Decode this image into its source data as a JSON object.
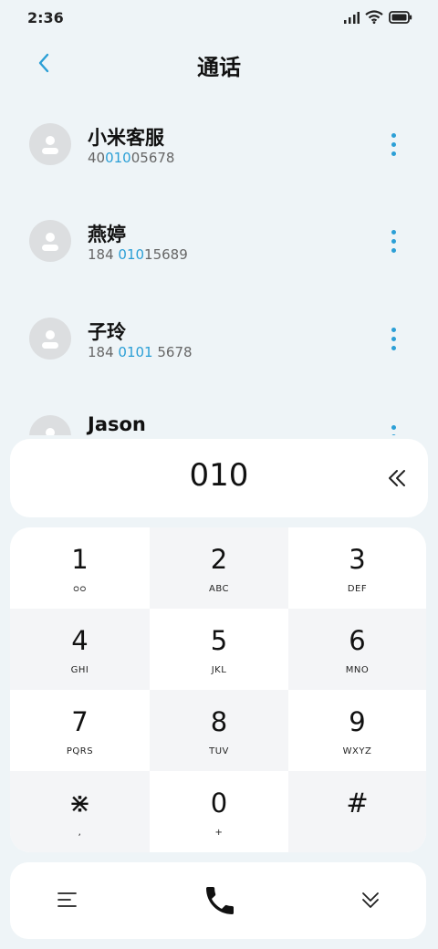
{
  "status_bar": {
    "time": "2:36"
  },
  "header": {
    "title": "通话"
  },
  "contacts": [
    {
      "name": "小米客服",
      "number_parts": [
        "40",
        "010",
        "05678"
      ]
    },
    {
      "name": "燕婷",
      "number_parts": [
        "184 ",
        "010",
        "15689"
      ]
    },
    {
      "name": "子玲",
      "number_parts": [
        "184 ",
        "0101",
        " 5678"
      ]
    },
    {
      "name": "Jason",
      "number_parts": [
        "",
        "",
        ""
      ]
    }
  ],
  "dialer": {
    "number": "010"
  },
  "keypad": [
    {
      "digit": "1",
      "letters": "ᴑᴑ"
    },
    {
      "digit": "2",
      "letters": "ABC"
    },
    {
      "digit": "3",
      "letters": "DEF"
    },
    {
      "digit": "4",
      "letters": "GHI"
    },
    {
      "digit": "5",
      "letters": "JKL"
    },
    {
      "digit": "6",
      "letters": "MNO"
    },
    {
      "digit": "7",
      "letters": "PQRS"
    },
    {
      "digit": "8",
      "letters": "TUV"
    },
    {
      "digit": "9",
      "letters": "WXYZ"
    },
    {
      "digit": "⋇",
      "letters": ","
    },
    {
      "digit": "0",
      "letters": "+"
    },
    {
      "digit": "#",
      "letters": ""
    }
  ],
  "colors": {
    "accent": "#2b9fd6",
    "background": "#eef4f7"
  }
}
